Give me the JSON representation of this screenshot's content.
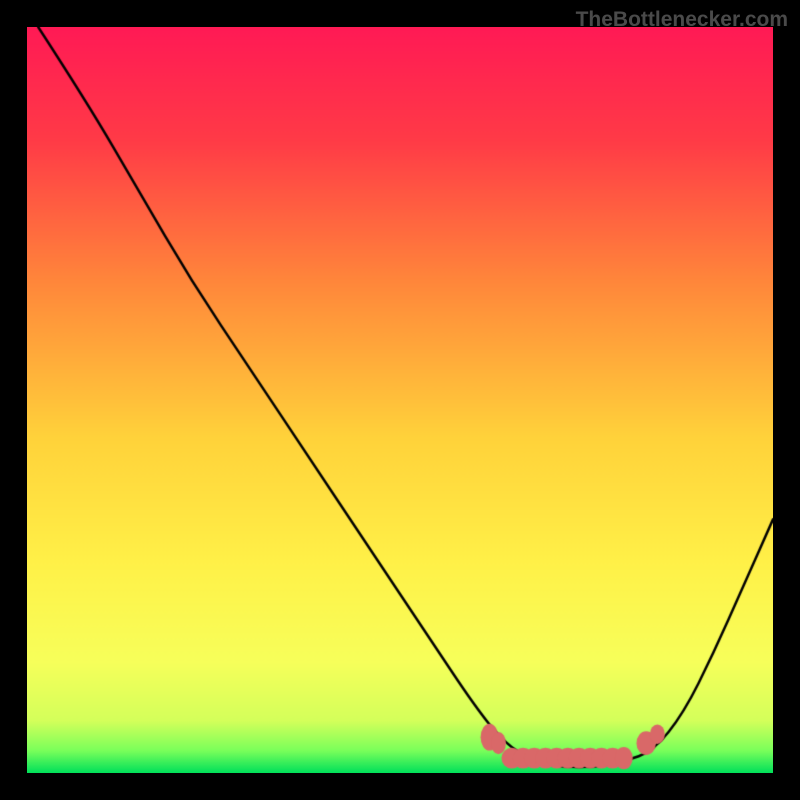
{
  "watermark": "TheBottlenecker.com",
  "chart_data": {
    "type": "line",
    "title": "",
    "xlabel": "",
    "ylabel": "",
    "xlim": [
      0,
      100
    ],
    "ylim": [
      0,
      100
    ],
    "gradient_note": "Background vertical gradient from red (top, high) through orange/yellow to green (bottom, low)",
    "curve": {
      "name": "bottleneck-curve",
      "points": [
        {
          "x": 1.5,
          "y": 100
        },
        {
          "x": 8,
          "y": 90
        },
        {
          "x": 15,
          "y": 78
        },
        {
          "x": 22,
          "y": 66
        },
        {
          "x": 30,
          "y": 54
        },
        {
          "x": 38,
          "y": 42
        },
        {
          "x": 46,
          "y": 30
        },
        {
          "x": 54,
          "y": 18
        },
        {
          "x": 60,
          "y": 9
        },
        {
          "x": 64,
          "y": 4
        },
        {
          "x": 68,
          "y": 1.5
        },
        {
          "x": 72,
          "y": 0.8
        },
        {
          "x": 76,
          "y": 0.8
        },
        {
          "x": 80,
          "y": 1.5
        },
        {
          "x": 84,
          "y": 3
        },
        {
          "x": 88,
          "y": 8
        },
        {
          "x": 92,
          "y": 16
        },
        {
          "x": 96,
          "y": 25
        },
        {
          "x": 100,
          "y": 34
        }
      ]
    },
    "dots": {
      "name": "data-dots",
      "color": "#d96868",
      "points": [
        {
          "x": 62,
          "y": 4.8,
          "rx": 1.2,
          "ry": 1.8
        },
        {
          "x": 63.2,
          "y": 4.0,
          "rx": 1.0,
          "ry": 1.5
        },
        {
          "x": 65,
          "y": 2.0,
          "rx": 1.4,
          "ry": 1.4
        },
        {
          "x": 66.5,
          "y": 2.0,
          "rx": 1.4,
          "ry": 1.4
        },
        {
          "x": 68,
          "y": 2.0,
          "rx": 1.4,
          "ry": 1.4
        },
        {
          "x": 69.5,
          "y": 2.0,
          "rx": 1.4,
          "ry": 1.4
        },
        {
          "x": 71,
          "y": 2.0,
          "rx": 1.4,
          "ry": 1.4
        },
        {
          "x": 72.5,
          "y": 2.0,
          "rx": 1.4,
          "ry": 1.4
        },
        {
          "x": 74,
          "y": 2.0,
          "rx": 1.4,
          "ry": 1.4
        },
        {
          "x": 75.5,
          "y": 2.0,
          "rx": 1.4,
          "ry": 1.4
        },
        {
          "x": 77,
          "y": 2.0,
          "rx": 1.4,
          "ry": 1.4
        },
        {
          "x": 78.5,
          "y": 2.0,
          "rx": 1.4,
          "ry": 1.4
        },
        {
          "x": 80,
          "y": 2.0,
          "rx": 1.2,
          "ry": 1.5
        },
        {
          "x": 83,
          "y": 4.0,
          "rx": 1.3,
          "ry": 1.6
        },
        {
          "x": 84.5,
          "y": 5.2,
          "rx": 1.0,
          "ry": 1.3
        }
      ]
    },
    "gradient_stops": [
      {
        "pos": 0,
        "color": "#ff1a55"
      },
      {
        "pos": 0.15,
        "color": "#ff3a47"
      },
      {
        "pos": 0.35,
        "color": "#ff8a3a"
      },
      {
        "pos": 0.55,
        "color": "#ffd23a"
      },
      {
        "pos": 0.72,
        "color": "#fff148"
      },
      {
        "pos": 0.85,
        "color": "#f7ff5a"
      },
      {
        "pos": 0.93,
        "color": "#d4ff5a"
      },
      {
        "pos": 0.97,
        "color": "#7aff5a"
      },
      {
        "pos": 1,
        "color": "#00e05a"
      }
    ]
  }
}
